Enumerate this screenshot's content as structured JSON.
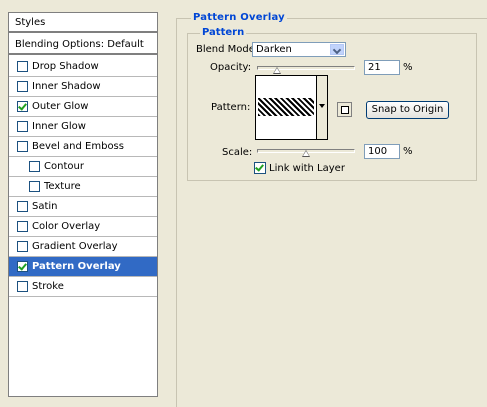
{
  "styles_panel": {
    "header": "Styles",
    "blending_options": "Blending Options: Default",
    "items": [
      {
        "label": "Drop Shadow",
        "checked": false,
        "indent": false,
        "selected": false
      },
      {
        "label": "Inner Shadow",
        "checked": false,
        "indent": false,
        "selected": false
      },
      {
        "label": "Outer Glow",
        "checked": true,
        "indent": false,
        "selected": false
      },
      {
        "label": "Inner Glow",
        "checked": false,
        "indent": false,
        "selected": false
      },
      {
        "label": "Bevel and Emboss",
        "checked": false,
        "indent": false,
        "selected": false
      },
      {
        "label": "Contour",
        "checked": false,
        "indent": true,
        "selected": false
      },
      {
        "label": "Texture",
        "checked": false,
        "indent": true,
        "selected": false
      },
      {
        "label": "Satin",
        "checked": false,
        "indent": false,
        "selected": false
      },
      {
        "label": "Color Overlay",
        "checked": false,
        "indent": false,
        "selected": false
      },
      {
        "label": "Gradient Overlay",
        "checked": false,
        "indent": false,
        "selected": false
      },
      {
        "label": "Pattern Overlay",
        "checked": true,
        "indent": false,
        "selected": true
      },
      {
        "label": "Stroke",
        "checked": false,
        "indent": false,
        "selected": false
      }
    ]
  },
  "pattern_overlay": {
    "title": "Pattern Overlay",
    "group_title": "Pattern",
    "blend_mode": {
      "label": "Blend Mode:",
      "value": "Darken"
    },
    "opacity": {
      "label": "Opacity:",
      "value": "21",
      "unit": "%"
    },
    "pattern": {
      "label": "Pattern:"
    },
    "snap_button": "Snap to Origin",
    "scale": {
      "label": "Scale:",
      "value": "100",
      "unit": "%"
    },
    "link_with_layer": {
      "label": "Link with Layer",
      "checked": true
    }
  },
  "colors": {
    "background": "#ece9d8",
    "selection": "#316ac5",
    "group_title": "#0046d5"
  }
}
